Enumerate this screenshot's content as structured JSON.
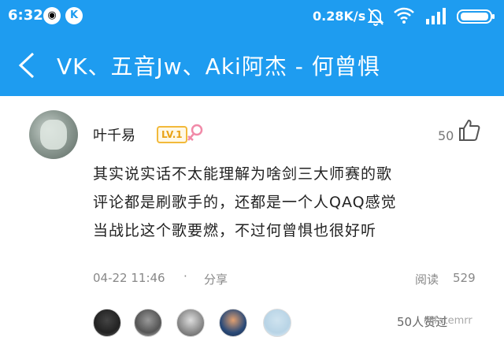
{
  "status_bar": {
    "time": "6:32",
    "qq_icon": "penguin-icon",
    "k_badge": "K",
    "net_speed": "0.28K/s",
    "icons": [
      "mute-bell-icon",
      "wifi-icon",
      "signal-icon",
      "battery-icon"
    ]
  },
  "header": {
    "back_icon": "chevron-left-icon",
    "title": "VK、五音Jw、Aki阿杰 - 何曾惧",
    "bg_color": "#1e9cf0"
  },
  "comment": {
    "username": "叶千易",
    "level": "LV.1",
    "gender_icon": "female-icon",
    "like_count": "50",
    "like_icon": "thumbs-up-icon",
    "text_lines": [
      "其实说实话不太能理解为啥剑三大师赛的歌",
      "评论都是刷歌手的，还都是一个人QAQ感觉",
      "当战比这个歌要燃，不过何曾惧也很好听"
    ],
    "date": "04-22 11:46",
    "dot": "·",
    "share_label": "分享",
    "read_label": "阅读",
    "read_count": "529",
    "liked_text": "50人赞过",
    "watermark": "@fatemrr"
  }
}
